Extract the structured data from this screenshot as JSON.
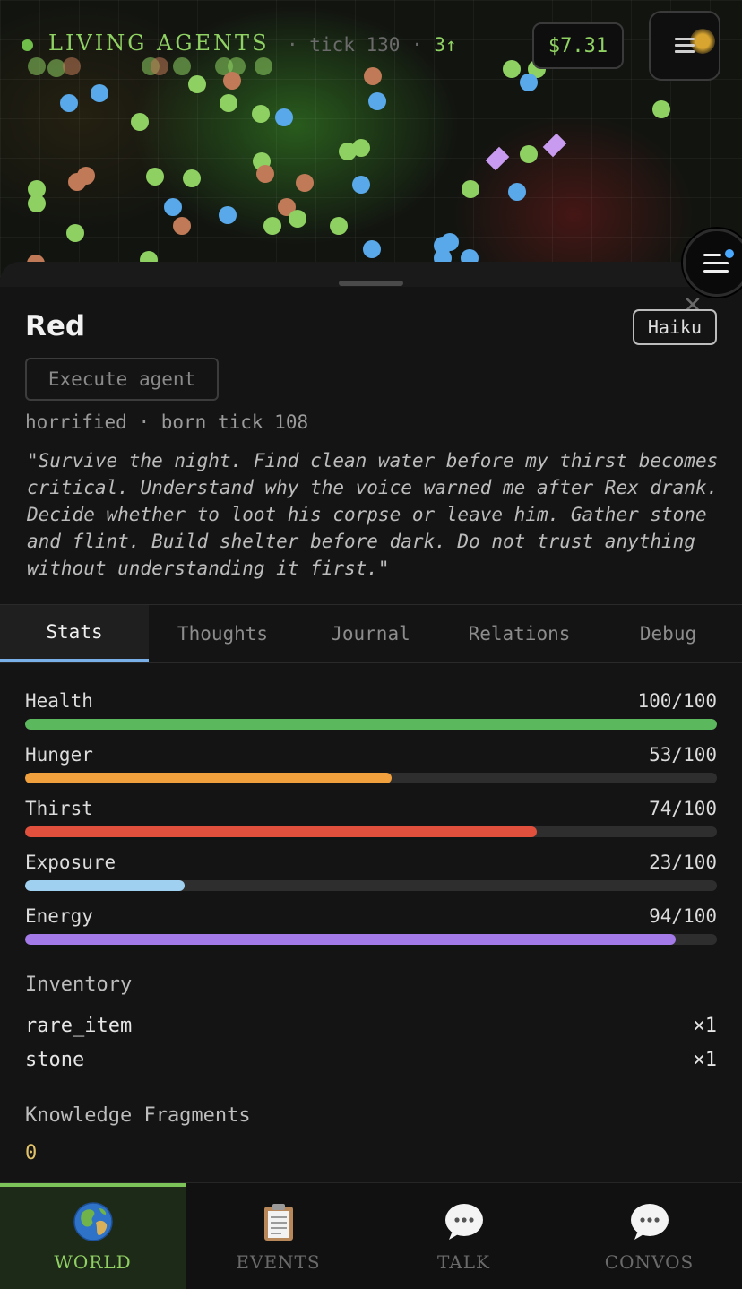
{
  "header": {
    "app_title": "LIVING AGENTS",
    "tick_label": "· tick 130 ·",
    "speed": "3↑",
    "cost": "$7.31",
    "menu_icon": "hamburger-icon",
    "theme_icon": "sun-icon"
  },
  "colors": {
    "accent_green": "#8fd163",
    "health": "#5cb85c",
    "hunger": "#f0a03c",
    "thirst": "#e0503c",
    "exposure": "#9fd0f0",
    "energy": "#a47ae8",
    "active_tab": "#7ab0e8"
  },
  "agent": {
    "name": "Red",
    "model": "Haiku",
    "execute_label": "Execute agent",
    "mood": "horrified",
    "born": "· born tick 108",
    "goal": "\"Survive the night. Find clean water before my thirst becomes critical. Understand why the voice warned me after Rex drank. Decide whether to loot his corpse or leave him. Gather stone and flint. Build shelter before dark. Do not trust anything without understanding it first.\""
  },
  "tabs": [
    {
      "label": "Stats",
      "active": true
    },
    {
      "label": "Thoughts",
      "active": false
    },
    {
      "label": "Journal",
      "active": false
    },
    {
      "label": "Relations",
      "active": false
    },
    {
      "label": "Debug",
      "active": false
    }
  ],
  "stats": [
    {
      "label": "Health",
      "value": 100,
      "max": 100,
      "display": "100/100",
      "color": "#5cb85c"
    },
    {
      "label": "Hunger",
      "value": 53,
      "max": 100,
      "display": "53/100",
      "color": "#f0a03c"
    },
    {
      "label": "Thirst",
      "value": 74,
      "max": 100,
      "display": "74/100",
      "color": "#e0503c"
    },
    {
      "label": "Exposure",
      "value": 23,
      "max": 100,
      "display": "23/100",
      "color": "#9fd0f0"
    },
    {
      "label": "Energy",
      "value": 94,
      "max": 100,
      "display": "94/100",
      "color": "#a47ae8"
    }
  ],
  "inventory": {
    "title": "Inventory",
    "items": [
      {
        "name": "rare_item",
        "qty": "×1"
      },
      {
        "name": "stone",
        "qty": "×1"
      }
    ]
  },
  "knowledge": {
    "title": "Knowledge Fragments",
    "value": "0"
  },
  "bottom_nav": [
    {
      "label": "WORLD",
      "icon": "globe-icon",
      "active": true
    },
    {
      "label": "EVENTS",
      "icon": "clipboard-icon",
      "active": false
    },
    {
      "label": "TALK",
      "icon": "speech-bubble-icon",
      "active": false
    },
    {
      "label": "CONVOS",
      "icon": "speech-bubble-icon",
      "active": false
    }
  ]
}
